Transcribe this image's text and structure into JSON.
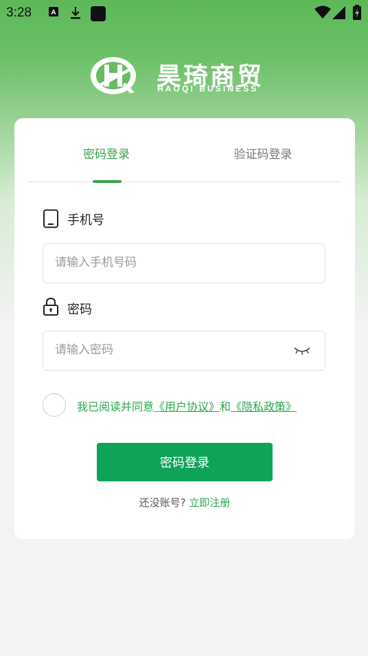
{
  "status_bar": {
    "time": "3:28"
  },
  "brand": {
    "name_cn": "昊琦商贸",
    "name_en": "HAOQI BUSINESS"
  },
  "tabs": [
    {
      "label": "密码登录",
      "active": true
    },
    {
      "label": "验证码登录",
      "active": false
    }
  ],
  "phone": {
    "label": "手机号",
    "placeholder": "请输入手机号码",
    "value": ""
  },
  "password": {
    "label": "密码",
    "placeholder": "请输入密码",
    "value": ""
  },
  "agreement": {
    "prefix": "我已阅读并同意",
    "user_agreement": "《用户协议》",
    "and": "和",
    "privacy_policy": "《隐私政策》",
    "checked": false
  },
  "login_button": "密码登录",
  "register": {
    "prompt": "还没账号?",
    "link": "立即注册"
  },
  "colors": {
    "accent": "#0fa35a",
    "tab_active": "#3aa14a",
    "link": "#2aa74c"
  }
}
